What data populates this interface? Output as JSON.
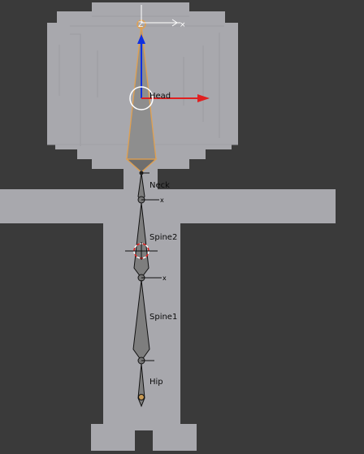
{
  "viewport": {
    "background": "#3a3a3a",
    "mesh_color": "#a8a8ad",
    "bone_color": "#8a8a8a",
    "selected_bone_outline": "#e0a050",
    "x_axis_color": "#e02020",
    "y_axis_color": "#1030e0"
  },
  "bones": {
    "head": "Head",
    "neck": "Neck",
    "spine2": "Spine2",
    "spine1": "Spine1",
    "hip": "Hip"
  },
  "gizmo": {
    "axis_z": "Z",
    "axis_x_glyph": "x",
    "close_glyph": "×"
  },
  "icons": {
    "manipulator": "transform-manipulator-icon",
    "pivot": "pivot-cursor-icon"
  }
}
